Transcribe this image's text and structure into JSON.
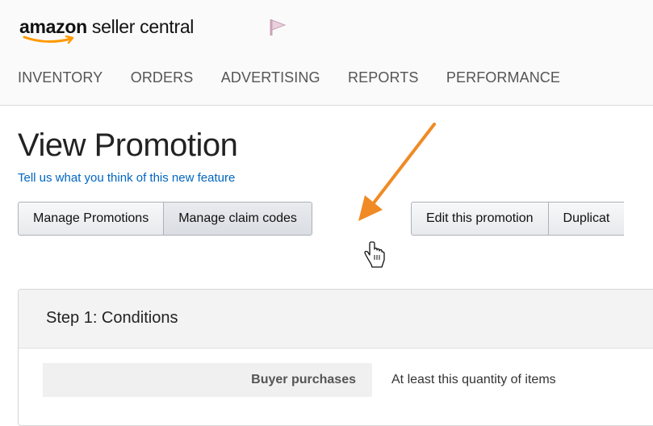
{
  "header": {
    "logo": {
      "brand": "amazon",
      "suffix": " seller central"
    },
    "flag_icon": "flag-icon",
    "nav": [
      "INVENTORY",
      "ORDERS",
      "ADVERTISING",
      "REPORTS",
      "PERFORMANCE"
    ]
  },
  "main": {
    "title": "View Promotion",
    "feedback_link": "Tell us what you think of this new feature",
    "buttons_group_1": [
      "Manage Promotions",
      "Manage claim codes"
    ],
    "buttons_group_2": [
      "Edit this promotion",
      "Duplicat"
    ],
    "hovered_button": "Manage claim codes"
  },
  "step1": {
    "title": "Step 1: Conditions",
    "rows": [
      {
        "label": "Buyer purchases",
        "value": "At least this quantity of items"
      }
    ]
  },
  "colors": {
    "link": "#0066c0",
    "arrow": "#f08a24",
    "amazon_smile": "#f90"
  }
}
